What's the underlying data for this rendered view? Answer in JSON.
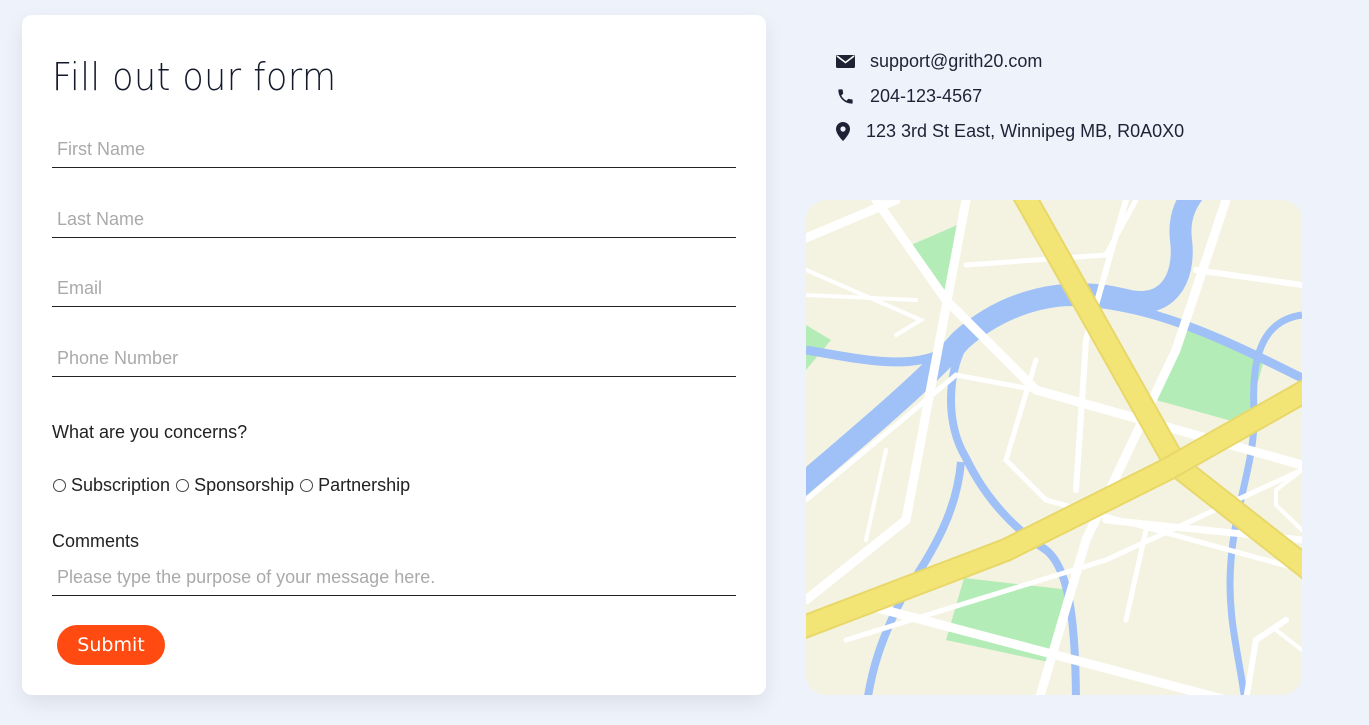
{
  "form": {
    "title": "Fill out our form",
    "first_name_placeholder": "First Name",
    "last_name_placeholder": "Last Name",
    "email_placeholder": "Email",
    "phone_placeholder": "Phone Number",
    "concerns_label": "What are you concerns?",
    "concern_options": [
      "Subscription",
      "Sponsorship",
      "Partnership"
    ],
    "comments_label": "Comments",
    "comments_placeholder": "Please type the purpose of your message here.",
    "submit_label": "Submit"
  },
  "contact": {
    "email": "support@grith20.com",
    "phone": "204-123-4567",
    "address": "123 3rd St East, Winnipeg MB, R0A0X0"
  },
  "icons": {
    "email": "envelope-icon",
    "phone": "phone-icon",
    "address": "map-marker-icon"
  },
  "colors": {
    "background": "#eef2fb",
    "card": "#ffffff",
    "accent": "#ff4a11",
    "text": "#1e2235",
    "map_land": "#f4f3e2",
    "map_water": "#9fc1f7",
    "map_highway": "#f2e475",
    "map_park": "#b4ecb7"
  }
}
